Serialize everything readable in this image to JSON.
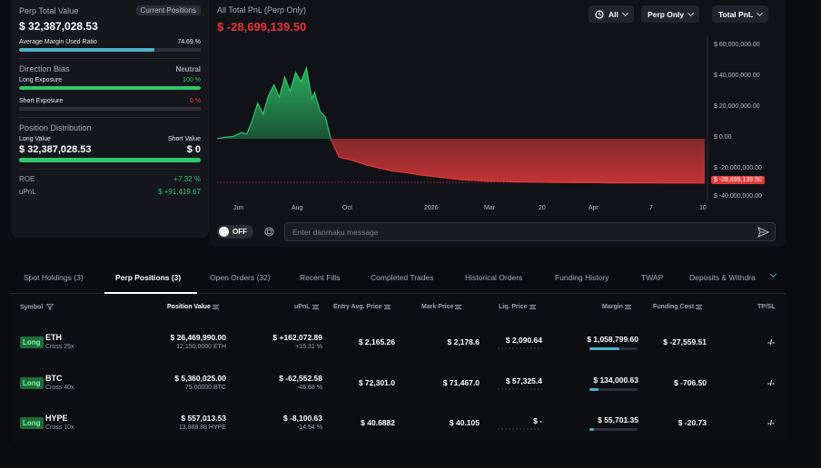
{
  "summary": {
    "perp_total_label": "Perp Total Value",
    "current_positions_label": "Current Positions",
    "perp_total_value": "$ 32,387,028.53",
    "avg_margin_label": "Average Margin Used Ratio",
    "avg_margin_value": "74.69 %",
    "avg_margin_fraction": 0.7469,
    "direction_bias_label": "Direction Bias",
    "direction_bias_value": "Neutral",
    "long_exposure_label": "Long Exposure",
    "long_exposure_value": "100 %",
    "short_exposure_label": "Short Exposure",
    "short_exposure_value": "0 %",
    "position_distribution_label": "Position Distribution",
    "long_value_label": "Long Value",
    "short_value_label": "Short Value",
    "long_value": "$ 32,387,028.53",
    "short_value": "$ 0",
    "roe_label": "ROE",
    "roe_value": "+7.32 %",
    "upnl_label": "uPnL",
    "upnl_value": "$ +91,419.67"
  },
  "chart": {
    "title": "All Total PnL (Perp Only)",
    "pnl_value": "$ -28,699,139.50",
    "filter_time": "All",
    "filter_scope": "Perp Only",
    "filter_metric": "Total PnL",
    "current_tag": "$ -28,699,139.50",
    "y_ticks": [
      "$ 60,000,000.00",
      "$ 40,000,000.00",
      "$ 20,000,000.00",
      "$ 0.00",
      "$ -20,000,000.00",
      "$ -40,000,000.00"
    ],
    "x_ticks": [
      "Jun",
      "Aug",
      "Oct",
      "2026",
      "Mar",
      "20",
      "Apr",
      "7",
      "10"
    ],
    "danmaku_toggle": "OFF",
    "danmaku_placeholder": "Enter danmaku message",
    "colors": {
      "positive": "#2fc76a",
      "negative": "#e23a3a"
    }
  },
  "chart_data": {
    "type": "area",
    "title": "All Total PnL (Perp Only)",
    "xlabel": "",
    "ylabel": "",
    "ylim": [
      -40000000,
      60000000
    ],
    "series": [
      {
        "x": [
          0,
          6,
          12,
          18,
          22,
          26,
          30,
          34,
          38,
          42,
          46,
          50,
          54,
          58,
          62,
          66,
          70,
          72,
          76,
          80,
          84,
          90,
          100,
          110,
          120,
          130,
          140,
          150,
          160,
          170,
          180,
          190,
          200,
          210,
          220,
          230,
          240,
          250,
          260,
          270,
          280,
          290,
          300,
          310,
          320,
          330,
          340,
          350,
          360
        ],
        "values": [
          0,
          1000000,
          1500000,
          4000000,
          3000000,
          12000000,
          23000000,
          16000000,
          28000000,
          35000000,
          27000000,
          40000000,
          31000000,
          43000000,
          37000000,
          46000000,
          26000000,
          30000000,
          18000000,
          14000000,
          0,
          -12000000,
          -14000000,
          -17000000,
          -19000000,
          -21000000,
          -22000000,
          -23500000,
          -24500000,
          -25500000,
          -26500000,
          -27000000,
          -27500000,
          -27500000,
          -28000000,
          -28000000,
          -28200000,
          -28300000,
          -28400000,
          -28500000,
          -28500000,
          -28600000,
          -28600000,
          -28650000,
          -28650000,
          -28700000,
          -28700000,
          -28700000,
          -28699139.5
        ]
      }
    ]
  },
  "tabs": [
    "Spot Holdings (3)",
    "Perp Positions (3)",
    "Open Orders (32)",
    "Recent Fills",
    "Completed Trades",
    "Historical Orders",
    "Funding History",
    "TWAP",
    "Deposits & Withdra"
  ],
  "table": {
    "headers": [
      "Symbol",
      "Position Value",
      "uPnL",
      "Entry Avg. Price",
      "Mark Price",
      "Liq. Price",
      "Margin",
      "Funding Cost",
      "TP/SL"
    ],
    "rows": [
      {
        "side": "Long",
        "symbol": "ETH",
        "leverage": "Cross 25x",
        "position_value": "$ 26,469,990.00",
        "size": "12,150.0000 ETH",
        "upnl": "$ +162,072.89",
        "upnl_pct": "+15.31 %",
        "entry": "$ 2,165.26",
        "mark": "$ 2,178.6",
        "liq": "$ 2,090.64",
        "margin": "$ 1,058,799.60",
        "margin_fraction": 0.62,
        "funding": "$ -27,559.51",
        "tpsl": "-/-"
      },
      {
        "side": "Long",
        "symbol": "BTC",
        "leverage": "Cross 40x",
        "position_value": "$ 5,360,025.00",
        "size": "75.00000 BTC",
        "upnl": "$ -62,552.58",
        "upnl_pct": "-46.68 %",
        "entry": "$ 72,301.0",
        "mark": "$ 71,467.0",
        "liq": "$ 57,325.4",
        "margin": "$ 134,000.63",
        "margin_fraction": 0.18,
        "funding": "$ -706.50",
        "tpsl": "-/-"
      },
      {
        "side": "Long",
        "symbol": "HYPE",
        "leverage": "Cross 10x",
        "position_value": "$ 557,013.53",
        "size": "13,888.88 HYPE",
        "upnl": "$ -8,100.63",
        "upnl_pct": "-14.54 %",
        "entry": "$ 40.6882",
        "mark": "$ 40.105",
        "liq": "$ -",
        "margin": "$ 55,701.35",
        "margin_fraction": 0.1,
        "funding": "$ -20.73",
        "tpsl": "-/-"
      }
    ]
  }
}
